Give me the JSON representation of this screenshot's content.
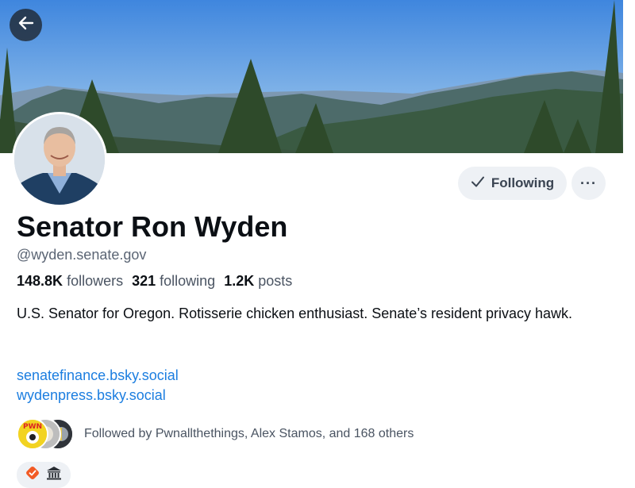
{
  "header": {
    "back_icon": "arrow-left-icon"
  },
  "profile": {
    "display_name": "Senator Ron Wyden",
    "handle": "@wyden.senate.gov",
    "stats": {
      "followers_count": "148.8K",
      "followers_label": "followers",
      "following_count": "321",
      "following_label": "following",
      "posts_count": "1.2K",
      "posts_label": "posts"
    },
    "bio": "U.S. Senator for Oregon. Rotisserie chicken enthusiast. Senate’s resident privacy hawk.",
    "links": [
      "senatefinance.bsky.social",
      "wydenpress.bsky.social"
    ],
    "followed_by": "Followed by Pwnallthethings, Alex Stamos, and 168 others",
    "mini_avatar_text": "PWN"
  },
  "actions": {
    "following_label": "Following",
    "more_label": "···"
  },
  "colors": {
    "link": "#1c7ee0",
    "badge_verified": "#f25a24",
    "sky": "#3f86de"
  }
}
